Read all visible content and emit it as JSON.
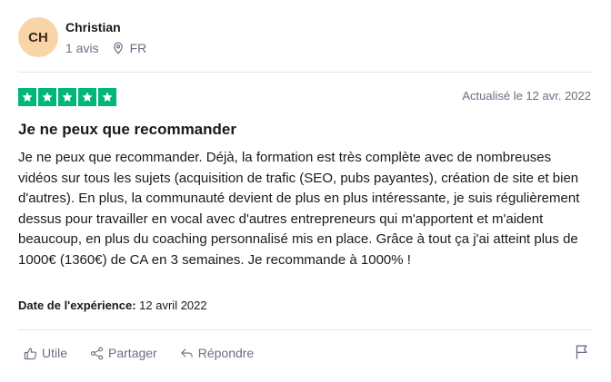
{
  "reviewer": {
    "initials": "CH",
    "name": "Christian",
    "reviews_count": "1 avis",
    "country": "FR"
  },
  "rating": {
    "stars": 5,
    "max": 5
  },
  "updated": "Actualisé le 12 avr. 2022",
  "review": {
    "title": "Je ne peux que recommander",
    "body": "Je ne peux que recommander. Déjà, la formation est très complète avec de nombreuses vidéos sur tous les sujets (acquisition de trafic (SEO, pubs payantes), création de site et bien d'autres). En plus, la communauté devient de plus en plus intéressante, je suis régulièrement dessus pour travailler en vocal avec d'autres entrepreneurs qui m'apportent et m'aident beaucoup, en plus du coaching personnalisé mis en place. Grâce à tout ça j'ai atteint plus de 1000€ (1360€) de CA en 3 semaines. Je recommande à 1000% !"
  },
  "experience": {
    "label": "Date de l'expérience:",
    "date": "12 avril 2022"
  },
  "actions": {
    "useful": "Utile",
    "share": "Partager",
    "reply": "Répondre"
  },
  "colors": {
    "star_green": "#00b67a",
    "avatar_bg": "#f9d4a8",
    "muted_text": "#6c6c85"
  },
  "icons": [
    "map-pin-icon",
    "star-icon",
    "thumbs-up-icon",
    "share-icon",
    "reply-icon",
    "flag-icon"
  ]
}
